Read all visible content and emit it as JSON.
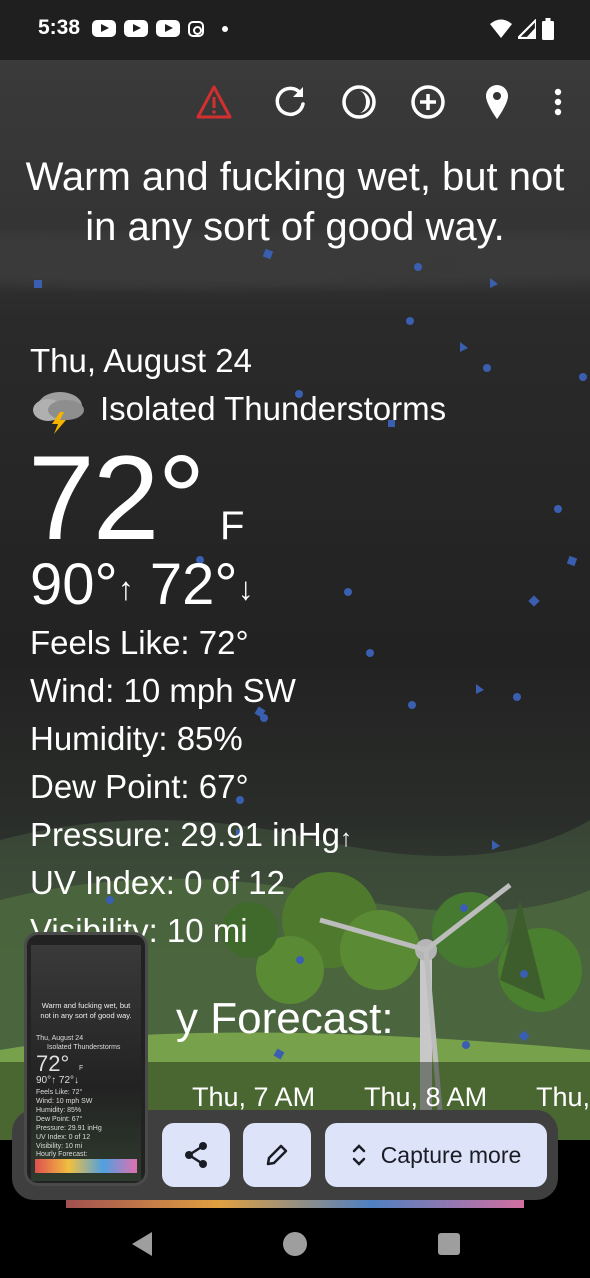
{
  "status_bar": {
    "time": "5:38",
    "notification_icons": [
      "youtube-icon",
      "youtube-icon",
      "youtube-icon",
      "instagram-icon",
      "dot-icon"
    ],
    "system_icons": [
      "wifi-icon",
      "signal-icon",
      "battery-icon"
    ]
  },
  "toolbar": {
    "icons": [
      "warning-icon",
      "refresh-icon",
      "theme-icon",
      "add-location-icon",
      "location-pin-icon",
      "more-vert-icon"
    ],
    "warning_color": "#d32f2f"
  },
  "weather": {
    "headline": "Warm and fucking wet, but not in any sort of good way.",
    "date": "Thu, August 24",
    "condition": "Isolated Thunderstorms",
    "condition_icon": "thunderstorm-icon",
    "temperature": "72°",
    "unit": "F",
    "high": "90°",
    "low": "72°",
    "details": [
      "Feels Like:  72°",
      "Wind:  10 mph SW",
      "Humidity:  85%",
      "Dew Point:  67°",
      "Pressure:  29.91 inHg",
      "UV Index:  0 of 12",
      "Visibility:  10 mi"
    ],
    "pressure_trend": "↑",
    "forecast_title": "Hourly Forecast:",
    "forecast_title_visible": "y Forecast:",
    "hours": [
      "Thu, 7 AM",
      "Thu, 8 AM",
      "Thu,"
    ]
  },
  "capture": {
    "share_icon": "share-icon",
    "edit_icon": "edit-icon",
    "capture_more_label": "Capture more",
    "expand_icon": "expand-icon"
  },
  "thumbnail": {
    "headline_line1": "Warm and fucking wet, but",
    "headline_line2": "not in any sort of good way.",
    "date": "Thu, August 24",
    "condition": "Isolated Thunderstorms",
    "temperature": "72°",
    "unit": "F",
    "hilo": "90°↑ 72°↓",
    "details": [
      "Feels Like:  72°",
      "Wind:  10 mph SW",
      "Humidity:  85%",
      "Dew Point:  67°",
      "Pressure:  29.91 inHg",
      "UV Index:  0 of 12",
      "Visibility:  10 mi"
    ],
    "forecast": "Hourly Forecast:"
  },
  "navigation": {
    "back": "back-icon",
    "home": "home-icon",
    "recents": "recents-icon"
  }
}
